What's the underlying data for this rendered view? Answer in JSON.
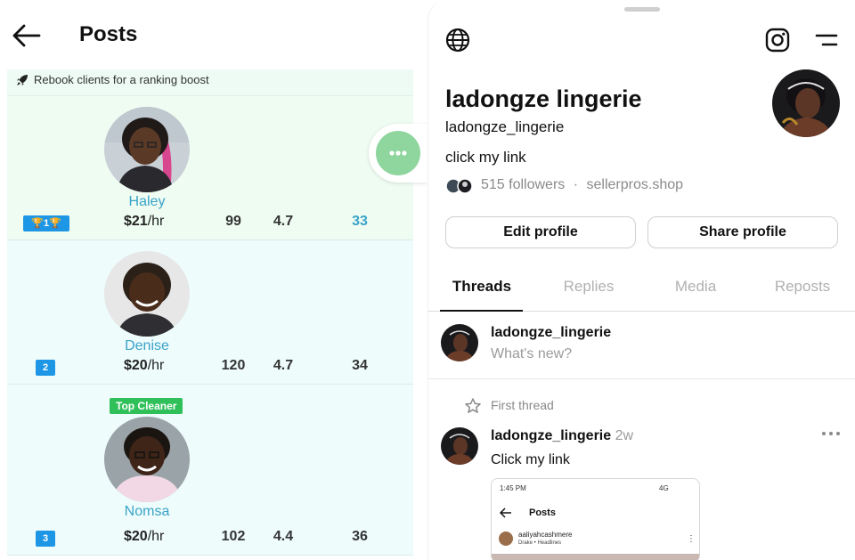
{
  "left_panel": {
    "header": {
      "title": "Posts"
    },
    "banner": {
      "text": "Rebook clients for a ranking boost"
    },
    "cleaners": [
      {
        "name": "Haley",
        "rank": "1",
        "rate_amount": "$21",
        "rate_unit": "/hr",
        "reviews": "99",
        "rating": "4.7",
        "jobs": "33"
      },
      {
        "name": "Denise",
        "rank": "2",
        "rate_amount": "$20",
        "rate_unit": "/hr",
        "reviews": "120",
        "rating": "4.7",
        "jobs": "34"
      },
      {
        "name": "Nomsa",
        "rank": "3",
        "rate_amount": "$20",
        "rate_unit": "/hr",
        "reviews": "102",
        "rating": "4.4",
        "jobs": "36",
        "badge": "Top Cleaner"
      }
    ]
  },
  "right_panel": {
    "profile": {
      "display_name": "ladongze lingerie",
      "handle": "ladongze_lingerie",
      "bio": "click my link",
      "followers": "515 followers",
      "separator": "·",
      "link": "sellerpros.shop"
    },
    "buttons": {
      "edit": "Edit profile",
      "share": "Share profile"
    },
    "tabs": [
      "Threads",
      "Replies",
      "Media",
      "Reposts"
    ],
    "active_tab": "Threads",
    "composer": {
      "username": "ladongze_lingerie",
      "placeholder": "What's new?"
    },
    "first_thread_label": "First thread",
    "post": {
      "username": "ladongze_lingerie",
      "time": "2w",
      "text": "Click my link",
      "embed": {
        "status_time": "1:45 PM",
        "signal": "4G",
        "title": "Posts",
        "user": "aaliyahcashmere",
        "music": "Drake • Headlines"
      }
    }
  },
  "colors": {
    "accent_blue": "#3aa3c8",
    "rank_badge": "#1e96e6",
    "top_cleaner_green": "#2fc05a",
    "fab_green": "#8fd59e"
  },
  "icons": [
    "back-arrow-icon",
    "rocket-icon",
    "trophy-icon",
    "more-dots-icon",
    "globe-icon",
    "instagram-icon",
    "menu-icon",
    "star-icon"
  ]
}
